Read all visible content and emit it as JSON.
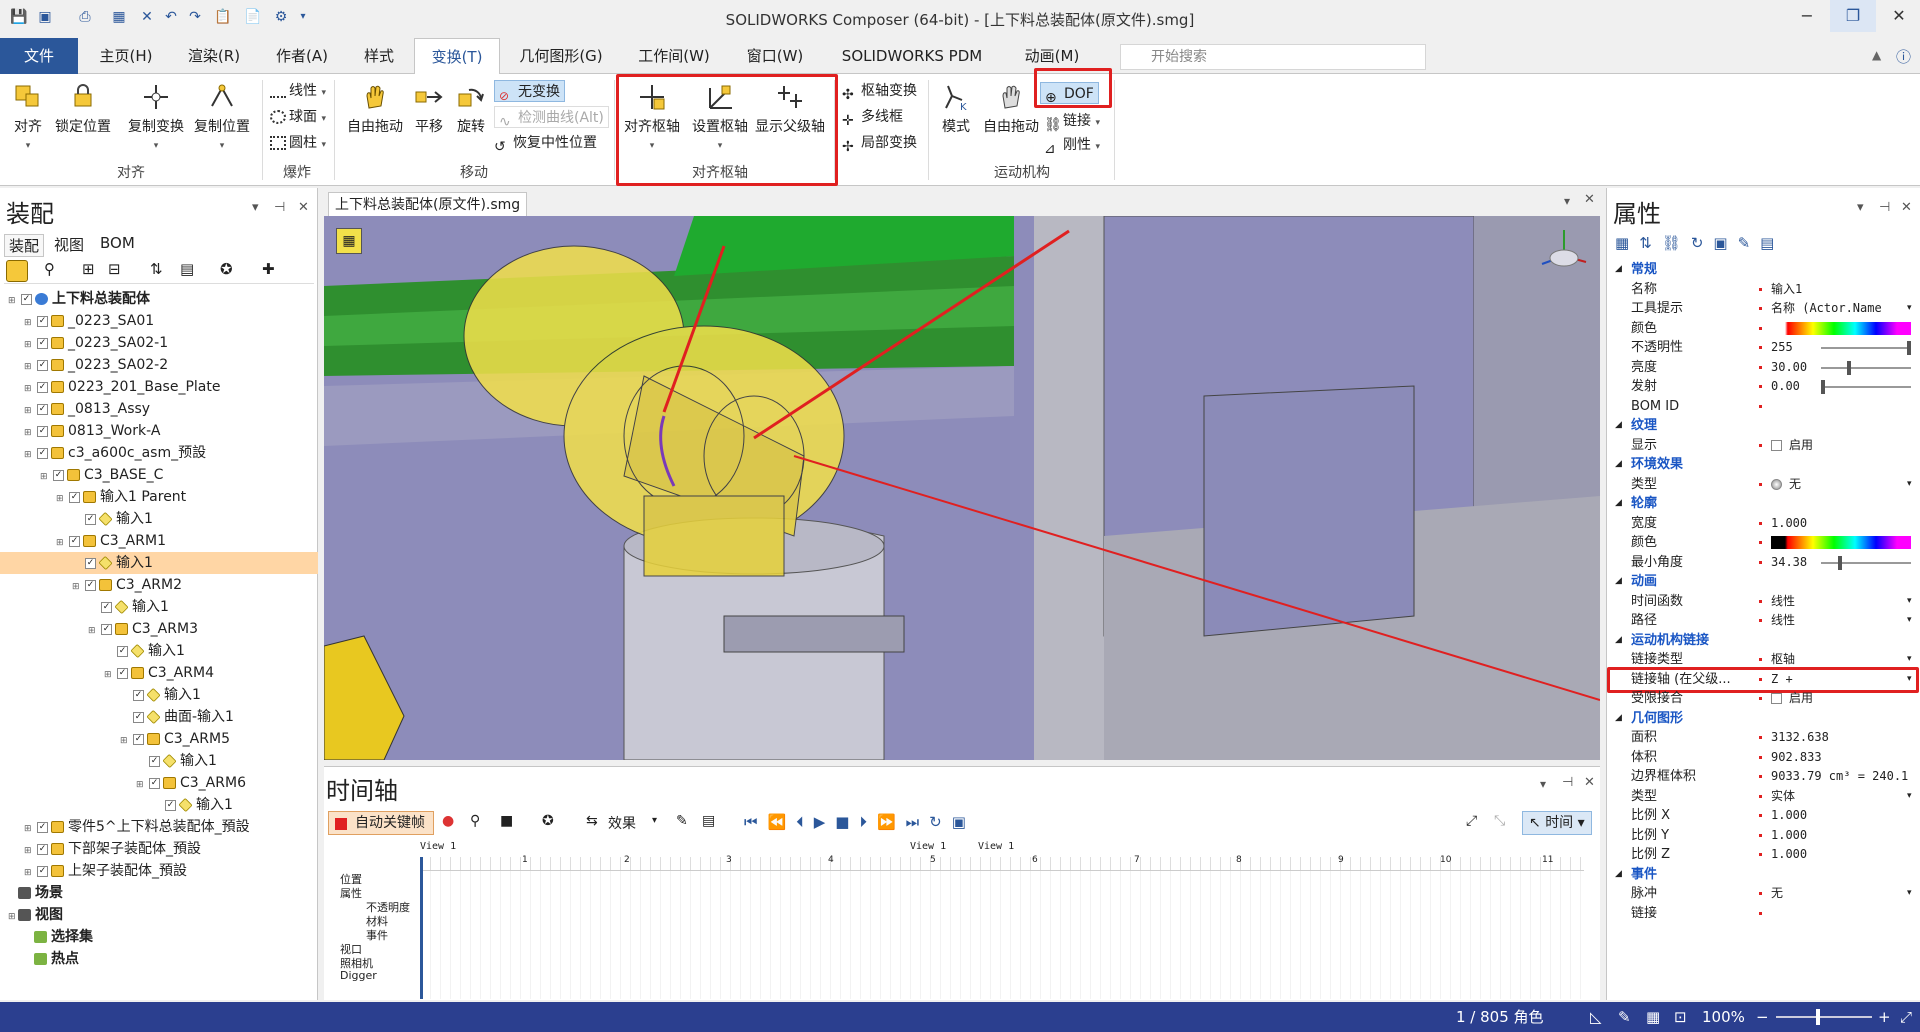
{
  "window": {
    "title": "SOLIDWORKS Composer (64-bit) - [上下料总装配体(原文件).smg]",
    "controls": [
      "−",
      "❐",
      "✕"
    ]
  },
  "ribbon_tabs": [
    "文件",
    "主页(H)",
    "渲染(R)",
    "作者(A)",
    "样式",
    "变换(T)",
    "几何图形(G)",
    "工作间(W)",
    "窗口(W)",
    "SOLIDWORKS PDM",
    "动画(M)"
  ],
  "search": {
    "placeholder": "开始搜索"
  },
  "ribbon": {
    "align_group": {
      "label": "对齐",
      "align": "对齐",
      "lock_position": "锁定位置",
      "copy_transform": "复制变换",
      "copy_position": "复制位置"
    },
    "explode_group": {
      "label": "爆炸",
      "linear": "线性",
      "sphere": "球面",
      "cylinder": "圆柱"
    },
    "move_group": {
      "label": "移动",
      "free_drag": "自由拖动",
      "translate": "平移",
      "rotate": "旋转",
      "no_transform": "无变换",
      "detect_curve": "检测曲线(Alt)",
      "restore_neutral": "恢复中性位置"
    },
    "pivot_group": {
      "label": "对齐枢轴",
      "align_pivot": "对齐枢轴",
      "set_pivot": "设置枢轴",
      "show_parent_pivot": "显示父级轴"
    },
    "pivot_small": {
      "pivot_transform": "枢轴变换",
      "multi_bbox": "多线框",
      "local_transform": "局部变换"
    },
    "kinematic_group": {
      "label": "运动机构",
      "mode": "模式",
      "free_drag": "自由拖动",
      "dof": "DOF",
      "link": "链接",
      "rigid": "刚性"
    }
  },
  "left_panel": {
    "title": "装配",
    "subtabs": [
      "装配",
      "视图",
      "BOM"
    ],
    "tree": [
      {
        "label": "上下料总装配体",
        "depth": 0,
        "kind": "root",
        "bold": true
      },
      {
        "label": "_0223_SA01",
        "depth": 1,
        "kind": "asm"
      },
      {
        "label": "_0223_SA02-1",
        "depth": 1,
        "kind": "asm"
      },
      {
        "label": "_0223_SA02-2",
        "depth": 1,
        "kind": "asm"
      },
      {
        "label": "0223_201_Base_Plate",
        "depth": 1,
        "kind": "asm"
      },
      {
        "label": "_0813_Assy",
        "depth": 1,
        "kind": "asm"
      },
      {
        "label": "0813_Work-A",
        "depth": 1,
        "kind": "asm"
      },
      {
        "label": "c3_a600c_asm_预設",
        "depth": 1,
        "kind": "asm"
      },
      {
        "label": "C3_BASE_C",
        "depth": 2,
        "kind": "asm"
      },
      {
        "label": "输入1 Parent",
        "depth": 3,
        "kind": "asm"
      },
      {
        "label": "输入1",
        "depth": 4,
        "kind": "part"
      },
      {
        "label": "C3_ARM1",
        "depth": 3,
        "kind": "asm"
      },
      {
        "label": "输入1",
        "depth": 4,
        "kind": "part",
        "selected": true
      },
      {
        "label": "C3_ARM2",
        "depth": 4,
        "kind": "asm"
      },
      {
        "label": "输入1",
        "depth": 5,
        "kind": "part"
      },
      {
        "label": "C3_ARM3",
        "depth": 5,
        "kind": "asm"
      },
      {
        "label": "输入1",
        "depth": 6,
        "kind": "part"
      },
      {
        "label": "C3_ARM4",
        "depth": 6,
        "kind": "asm"
      },
      {
        "label": "输入1",
        "depth": 7,
        "kind": "part"
      },
      {
        "label": "曲面-输入1",
        "depth": 7,
        "kind": "part"
      },
      {
        "label": "C3_ARM5",
        "depth": 7,
        "kind": "asm"
      },
      {
        "label": "输入1",
        "depth": 8,
        "kind": "part"
      },
      {
        "label": "C3_ARM6",
        "depth": 8,
        "kind": "asm"
      },
      {
        "label": "输入1",
        "depth": 9,
        "kind": "part"
      },
      {
        "label": "零件5^上下料总装配体_預設",
        "depth": 1,
        "kind": "asm"
      },
      {
        "label": "下部架子装配体_預設",
        "depth": 1,
        "kind": "asm"
      },
      {
        "label": "上架子装配体_預設",
        "depth": 1,
        "kind": "asm"
      },
      {
        "label": "场景",
        "depth": 0,
        "kind": "scene",
        "bold": true
      },
      {
        "label": "视图",
        "depth": 0,
        "kind": "folder",
        "bold": true
      },
      {
        "label": "选择集",
        "depth": 1,
        "kind": "set",
        "bold": true
      },
      {
        "label": "热点",
        "depth": 1,
        "kind": "set",
        "bold": true
      }
    ]
  },
  "document": {
    "tab": "上下料总装配体(原文件).smg"
  },
  "timeline": {
    "title": "时间轴",
    "auto_key": "自动关键帧",
    "effects": "效果",
    "time_label": "时间",
    "markers": [
      "View 1",
      "View 1",
      "View 1"
    ],
    "ruler": [
      "1",
      "2",
      "3",
      "4",
      "5",
      "6",
      "7",
      "8",
      "9",
      "10",
      "11"
    ],
    "tracks": [
      "位置",
      "属性",
      "不透明度",
      "材料",
      "事件",
      "视口",
      "照相机",
      "Digger"
    ]
  },
  "right_panel": {
    "title": "属性",
    "rows": [
      {
        "type": "sec",
        "k": "常规"
      },
      {
        "k": "名称",
        "v": "输入1"
      },
      {
        "k": "工具提示",
        "v": "名称 (Actor.Name",
        "dd": true
      },
      {
        "k": "颜色",
        "v": "",
        "color": true
      },
      {
        "k": "不透明性",
        "v": "255",
        "slider": 1.0
      },
      {
        "k": "亮度",
        "v": "30.00",
        "slider": 0.3
      },
      {
        "k": "发射",
        "v": "0.00",
        "slider": 0.0
      },
      {
        "k": "BOM ID",
        "v": ""
      },
      {
        "type": "sec",
        "k": "纹理"
      },
      {
        "k": "显示",
        "v": "启用",
        "check": true
      },
      {
        "type": "sec",
        "k": "环境效果"
      },
      {
        "k": "类型",
        "v": "无",
        "sphere": true,
        "dd": true
      },
      {
        "type": "sec",
        "k": "轮廓"
      },
      {
        "k": "宽度",
        "v": "1.000"
      },
      {
        "k": "颜色",
        "v": "",
        "color": true,
        "black": true
      },
      {
        "k": "最小角度",
        "v": "34.38",
        "slider": 0.2
      },
      {
        "type": "sec",
        "k": "动画"
      },
      {
        "k": "时间函数",
        "v": "线性",
        "dd": true
      },
      {
        "k": "路径",
        "v": "线性",
        "dd": true
      },
      {
        "type": "sec",
        "k": "运动机构链接"
      },
      {
        "k": "链接类型",
        "v": "枢轴",
        "dd": true
      },
      {
        "k": "链接轴 (在父级...",
        "v": "Z +",
        "dd": true,
        "highlight": true
      },
      {
        "k": "受限接合",
        "v": "启用",
        "check": true
      },
      {
        "type": "sec",
        "k": "几何图形"
      },
      {
        "k": "面积",
        "v": "3132.638"
      },
      {
        "k": "体积",
        "v": "902.833"
      },
      {
        "k": "边界框体积",
        "v": "9033.79 cm³ = 240.1"
      },
      {
        "k": "类型",
        "v": "实体",
        "dd": true
      },
      {
        "k": "比例 X",
        "v": "1.000"
      },
      {
        "k": "比例 Y",
        "v": "1.000"
      },
      {
        "k": "比例 Z",
        "v": "1.000"
      },
      {
        "type": "sec",
        "k": "事件"
      },
      {
        "k": "脉冲",
        "v": "无",
        "dd": true
      },
      {
        "k": "链接",
        "v": ""
      }
    ]
  },
  "status": {
    "count": "1 / 805 角色",
    "zoom": "100%"
  },
  "colors": {
    "accent": "#2b579a",
    "highlight": "#e02020",
    "status_bg": "#2b3f8f",
    "viewport_bg": "#8a89b8",
    "robot": "#f2e04a"
  }
}
